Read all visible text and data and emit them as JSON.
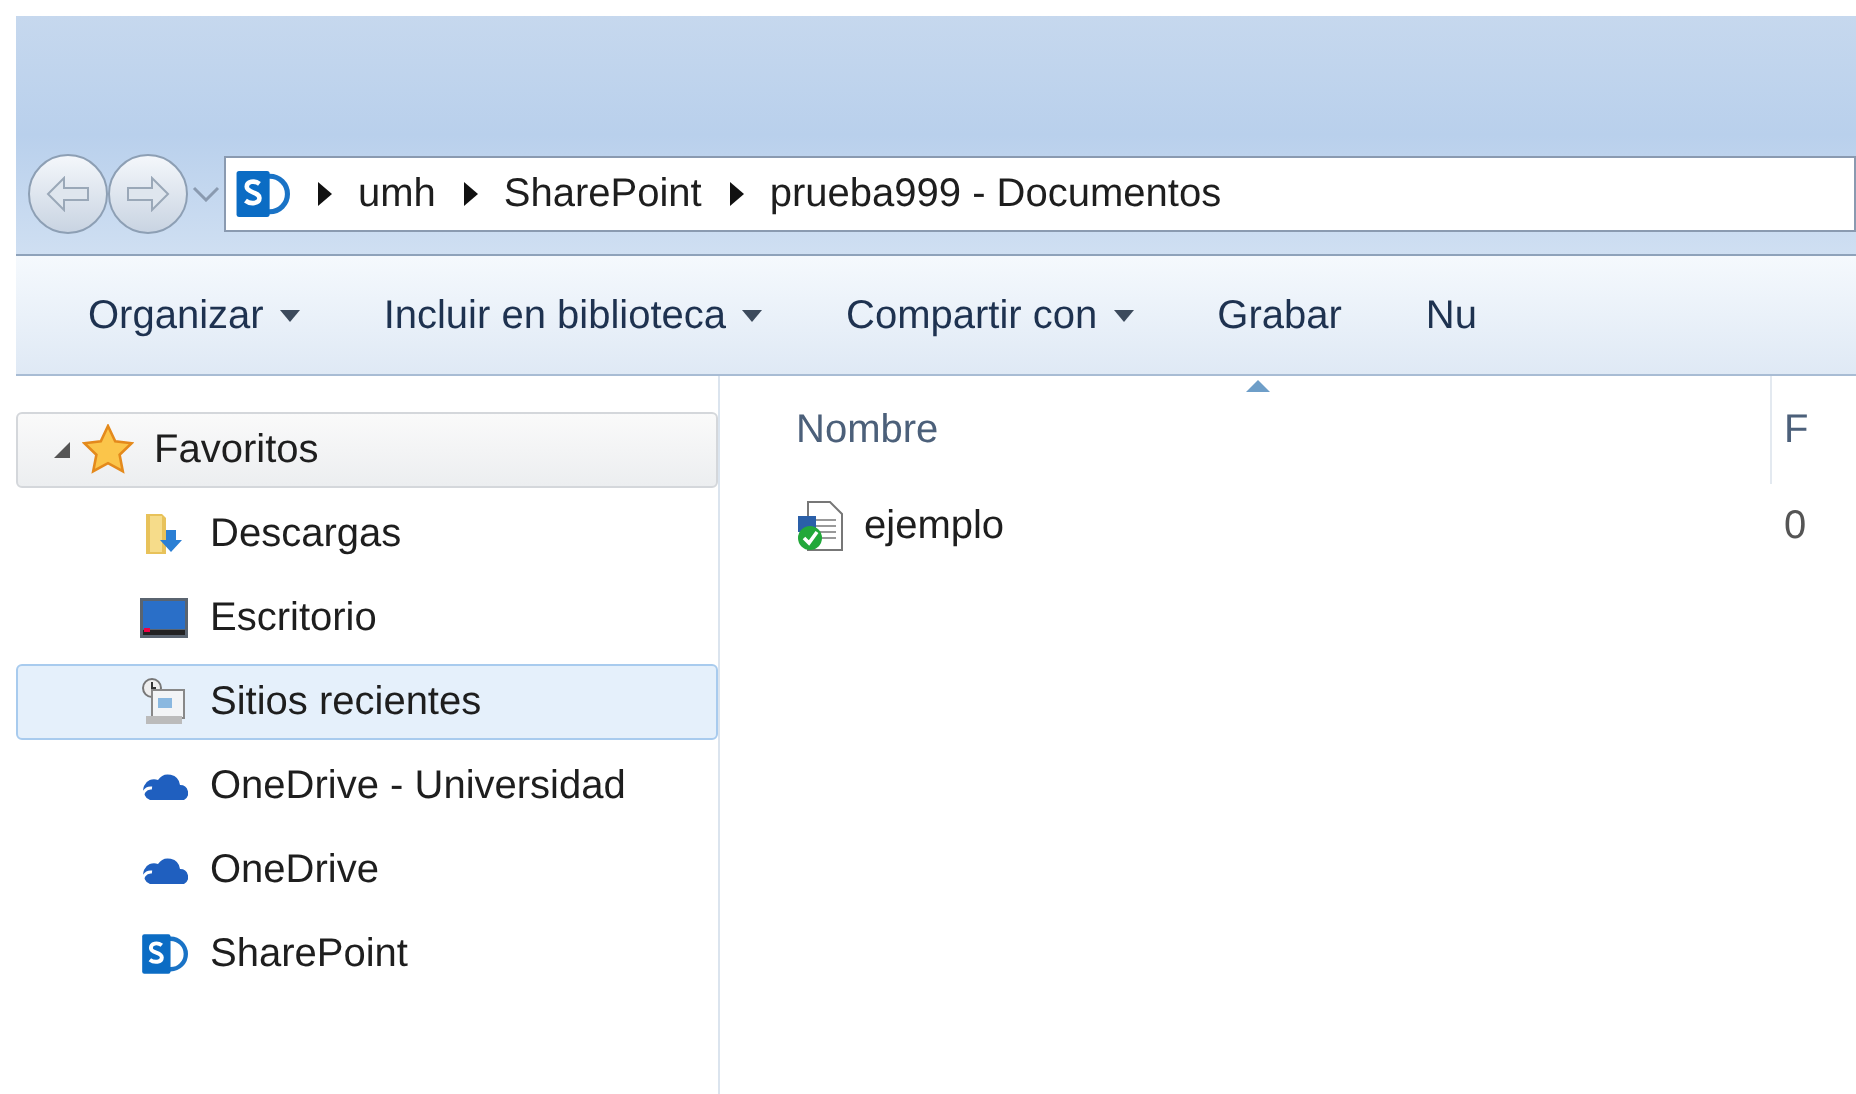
{
  "address_bar": {
    "segments": [
      "umh",
      "SharePoint",
      "prueba999 - Documentos"
    ]
  },
  "toolbar": [
    {
      "label": "Organizar",
      "has_menu": true
    },
    {
      "label": "Incluir en biblioteca",
      "has_menu": true
    },
    {
      "label": "Compartir con",
      "has_menu": true
    },
    {
      "label": "Grabar",
      "has_menu": false
    },
    {
      "label": "Nu",
      "has_menu": false
    }
  ],
  "sidebar": {
    "items": [
      {
        "label": "Favoritos",
        "kind": "star",
        "expanded": true,
        "selected": false,
        "children": [
          {
            "label": "Descargas",
            "kind": "downloads",
            "selected": false
          },
          {
            "label": "Escritorio",
            "kind": "desktop",
            "selected": false
          },
          {
            "label": "Sitios recientes",
            "kind": "recent",
            "selected": true
          },
          {
            "label": "OneDrive - Universidad",
            "kind": "cloud",
            "selected": false
          },
          {
            "label": "OneDrive",
            "kind": "cloud",
            "selected": false
          },
          {
            "label": "SharePoint",
            "kind": "sharepoint",
            "selected": false
          }
        ]
      }
    ]
  },
  "file_list": {
    "columns": [
      {
        "label": "Nombre",
        "sorted": true
      },
      {
        "label": "F",
        "sorted": false
      }
    ],
    "rows": [
      {
        "cells": [
          "ejemplo",
          "0"
        ],
        "synced": true
      }
    ]
  }
}
